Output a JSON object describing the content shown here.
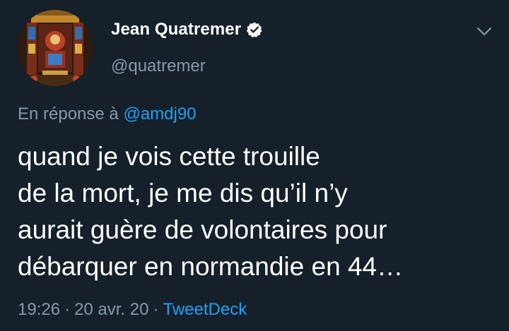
{
  "tweet": {
    "author": {
      "display_name": "Jean Quatremer",
      "handle": "@quatremer",
      "verified": true
    },
    "reply": {
      "prefix": "En réponse à",
      "mention": "@amdj90"
    },
    "text_lines": [
      "quand je vois cette trouille",
      "de la mort, je me dis qu’il n’y",
      "aurait guère de volontaires pour",
      "débarquer en normandie en 44…"
    ],
    "meta": {
      "time": "19:26",
      "separator": "·",
      "date": "20 avr. 20",
      "source": "TweetDeck"
    }
  },
  "icons": {
    "verified": "verified-badge-icon",
    "menu": "chevron-down-icon"
  },
  "colors": {
    "background": "#15202b",
    "text": "#ffffff",
    "secondary_text": "#8899a6",
    "link": "#1da1f2"
  }
}
